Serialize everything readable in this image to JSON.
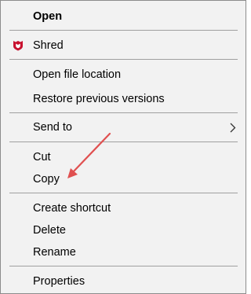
{
  "menu": {
    "items": [
      {
        "label": "Open"
      },
      {
        "label": "Shred"
      },
      {
        "label": "Open file location"
      },
      {
        "label": "Restore previous versions"
      },
      {
        "label": "Send to"
      },
      {
        "label": "Cut"
      },
      {
        "label": "Copy"
      },
      {
        "label": "Create shortcut"
      },
      {
        "label": "Delete"
      },
      {
        "label": "Rename"
      },
      {
        "label": "Properties"
      }
    ]
  },
  "colors": {
    "menu_background": "#f2f2f2",
    "separator": "#a0a0a0",
    "mcafee_red": "#c8102e",
    "annotation_arrow": "#e05050"
  },
  "icons": {
    "shred": "mcafee-shield-icon",
    "send_to": "chevron-right-icon"
  }
}
